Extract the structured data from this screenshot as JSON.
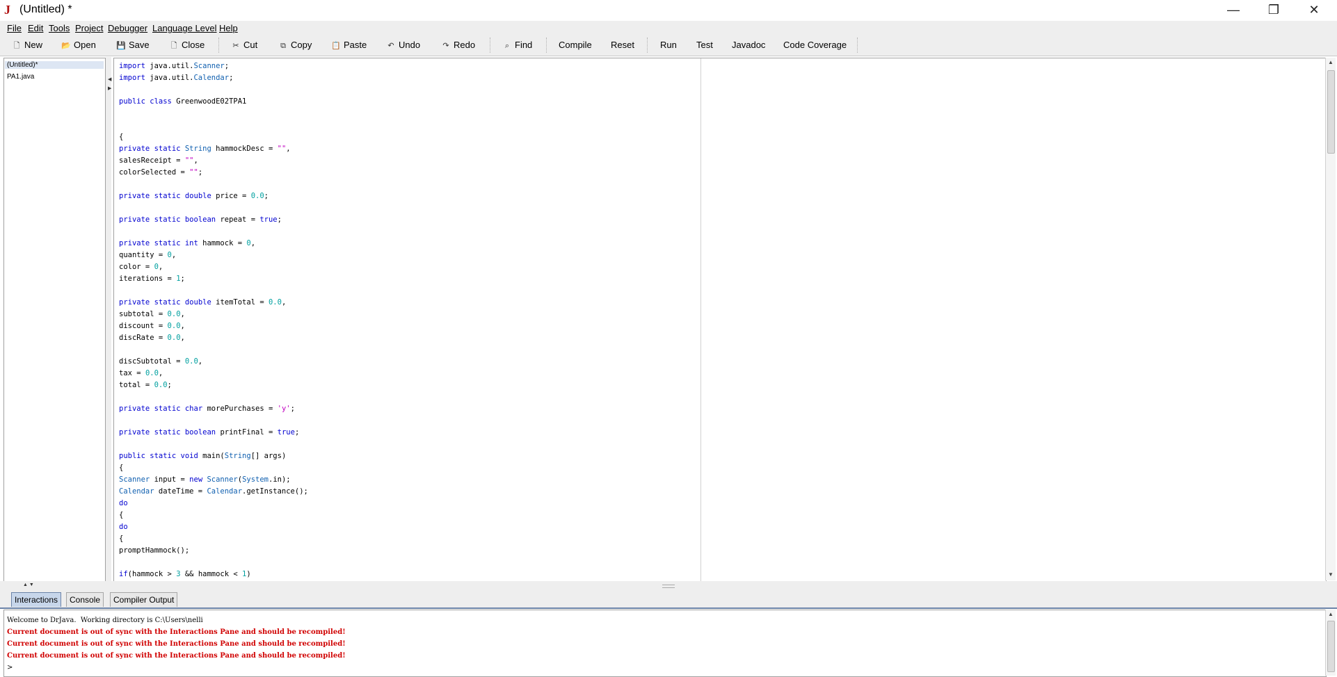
{
  "window": {
    "title": "(Untitled) *",
    "icon": "drjava-icon",
    "controls": {
      "minimize": "—",
      "maximize": "❐",
      "close": "✕"
    }
  },
  "menu": [
    "File",
    "Edit",
    "Tools",
    "Project",
    "Debugger",
    "Language Level",
    "Help"
  ],
  "toolbar": {
    "new": "New",
    "open": "Open",
    "save": "Save",
    "close": "Close",
    "cut": "Cut",
    "copy": "Copy",
    "paste": "Paste",
    "undo": "Undo",
    "redo": "Redo",
    "find": "Find",
    "compile": "Compile",
    "reset": "Reset",
    "run": "Run",
    "test": "Test",
    "javadoc": "Javadoc",
    "coverage": "Code Coverage"
  },
  "documents": [
    "(Untitled)*",
    "PA1.java"
  ],
  "code_lines": [
    "import java.util.Scanner;",
    "import java.util.Calendar;",
    "",
    "public class GreenwoodE02TPA1",
    "",
    "",
    "{",
    "private static String hammockDesc = \"\",",
    "salesReceipt = \"\",",
    "colorSelected = \"\";",
    "",
    "private static double price = 0.0;",
    "",
    "private static boolean repeat = true;",
    "",
    "private static int hammock = 0,",
    "quantity = 0,",
    "color = 0,",
    "iterations = 1;",
    "",
    "private static double itemTotal = 0.0,",
    "subtotal = 0.0,",
    "discount = 0.0,",
    "discRate = 0.0,",
    "",
    "discSubtotal = 0.0,",
    "tax = 0.0,",
    "total = 0.0;",
    "",
    "private static char morePurchases = 'y';",
    "",
    "private static boolean printFinal = true;",
    "",
    "public static void main(String[] args)",
    "{",
    "Scanner input = new Scanner(System.in);",
    "Calendar dateTime = Calendar.getInstance();",
    "do",
    "{",
    "do",
    "{",
    "promptHammock();",
    "",
    "if(hammock > 3 && hammock < 1)"
  ],
  "bottom_tabs": [
    "Interactions",
    "Console",
    "Compiler Output"
  ],
  "interactions": {
    "welcome": "Welcome to DrJava.  Working directory is C:\\Users\\nelli",
    "errors": [
      "Current document is out of sync with the Interactions Pane and should be recompiled!",
      "Current document is out of sync with the Interactions Pane and should be recompiled!",
      "Current document is out of sync with the Interactions Pane and should be recompiled!"
    ],
    "prompt": ">"
  },
  "colors": {
    "keyword": "#0000d0",
    "type": "#1060b0",
    "number": "#00a0a0",
    "string": "#c000c0",
    "error": "#d00000",
    "tab_active": "#c7d6ea"
  }
}
